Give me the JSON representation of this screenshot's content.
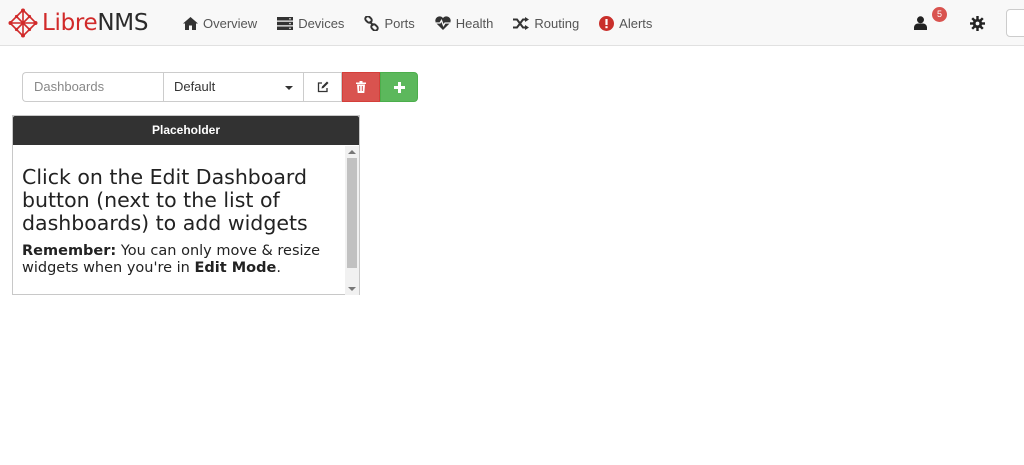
{
  "brand": {
    "part1": "Libre",
    "part2": "NMS",
    "accent": "#d12a2a"
  },
  "nav": [
    {
      "label": "Overview",
      "icon": "home-icon"
    },
    {
      "label": "Devices",
      "icon": "server-icon"
    },
    {
      "label": "Ports",
      "icon": "link-icon"
    },
    {
      "label": "Health",
      "icon": "heartbeat-icon"
    },
    {
      "label": "Routing",
      "icon": "random-icon"
    },
    {
      "label": "Alerts",
      "icon": "exclamation-circle-icon"
    }
  ],
  "user": {
    "icon": "user-icon",
    "badge_count": "5"
  },
  "settings": {
    "icon": "gear-icon"
  },
  "dashboard": {
    "label": "Dashboards",
    "selected": "Default",
    "edit_icon": "edit-icon",
    "delete_icon": "trash-icon",
    "add_icon": "plus-icon",
    "colors": {
      "delete": "#d9534f",
      "add": "#5cb85c"
    }
  },
  "widget": {
    "title": "Placeholder",
    "heading": "Click on the Edit Dashboard button (next to the list of dashboards) to add widgets",
    "remember_label": "Remember:",
    "remember_text": " You can only move & resize widgets when you're in ",
    "edit_mode": "Edit Mode",
    "period": "."
  }
}
